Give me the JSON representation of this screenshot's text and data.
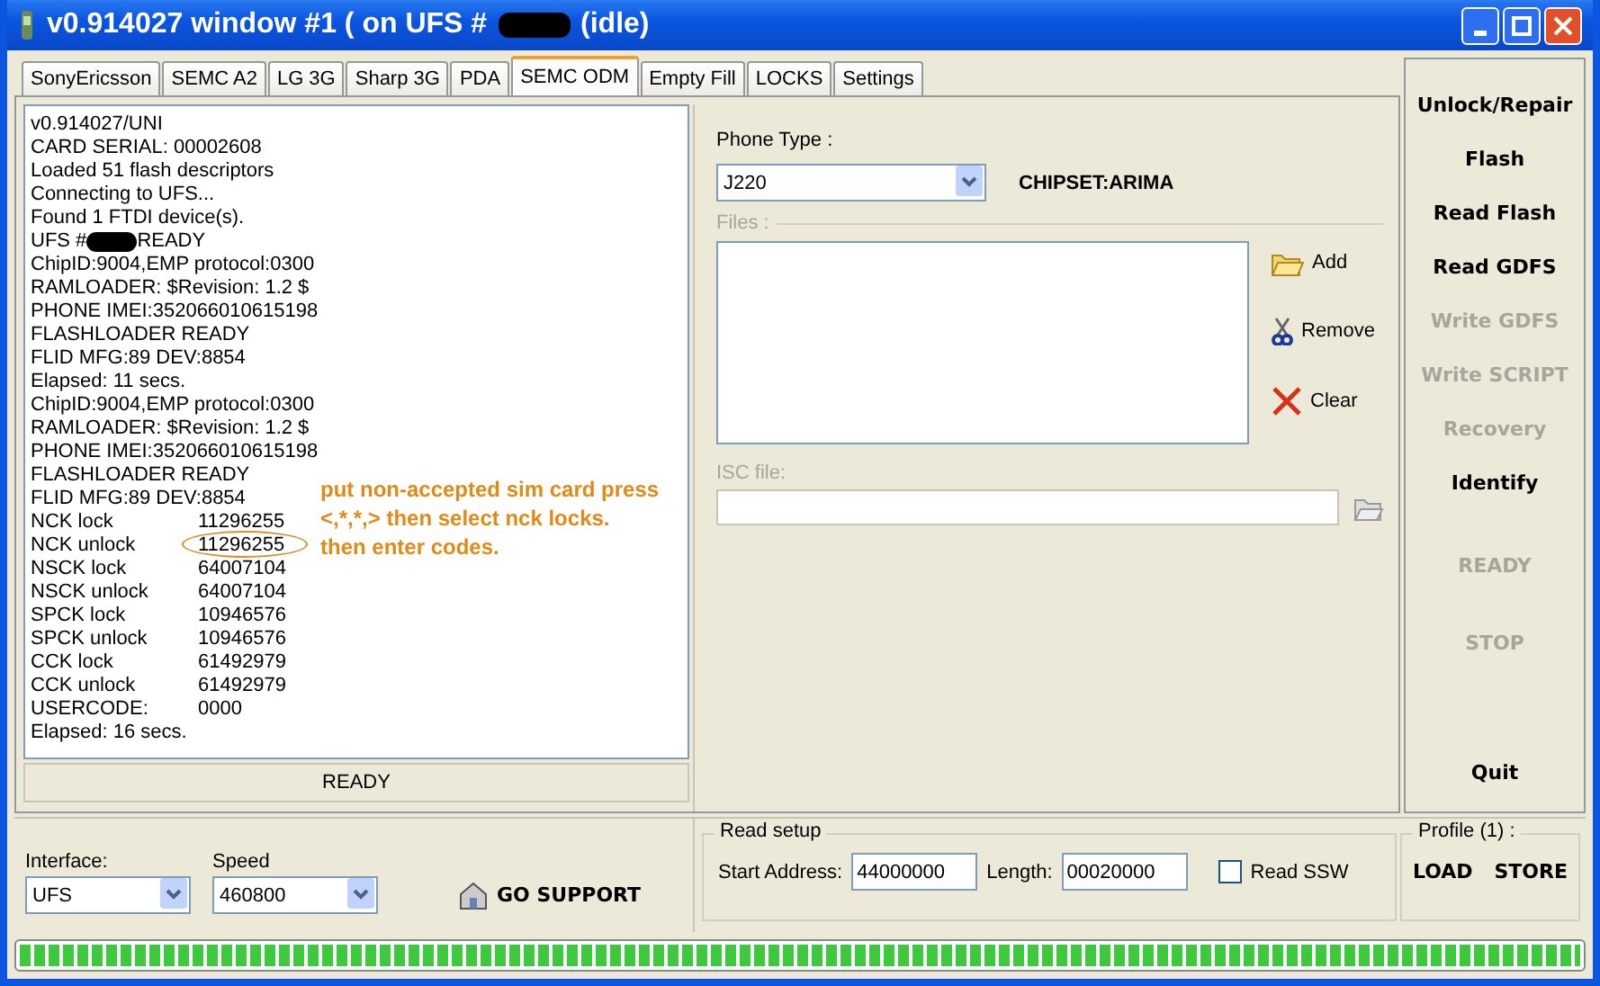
{
  "window": {
    "title_before": "v0.914027 window #1 ( on UFS #",
    "title_after": "(idle)"
  },
  "tabs": [
    {
      "label": "SonyEricsson",
      "selected": false
    },
    {
      "label": "SEMC A2",
      "selected": false
    },
    {
      "label": "LG 3G",
      "selected": false
    },
    {
      "label": "Sharp 3G",
      "selected": false
    },
    {
      "label": "PDA",
      "selected": false
    },
    {
      "label": "SEMC ODM",
      "selected": true
    },
    {
      "label": "Empty Fill",
      "selected": false
    },
    {
      "label": "LOCKS",
      "selected": false
    },
    {
      "label": "Settings",
      "selected": false
    }
  ],
  "log": {
    "lines": [
      {
        "kind": "text",
        "text": "v0.914027/UNI"
      },
      {
        "kind": "text",
        "text": "CARD SERIAL: 00002608"
      },
      {
        "kind": "text",
        "text": "Loaded 51 flash descriptors"
      },
      {
        "kind": "text",
        "text": "Connecting to UFS..."
      },
      {
        "kind": "text",
        "text": "Found 1 FTDI device(s)."
      },
      {
        "kind": "redacted",
        "before": "UFS #",
        "after": "READY"
      },
      {
        "kind": "text",
        "text": "ChipID:9004,EMP protocol:0300"
      },
      {
        "kind": "text",
        "text": "RAMLOADER: $Revision: 1.2 $"
      },
      {
        "kind": "text",
        "text": "PHONE IMEI:352066010615198"
      },
      {
        "kind": "text",
        "text": "FLASHLOADER READY"
      },
      {
        "kind": "text",
        "text": "FLID MFG:89 DEV:8854"
      },
      {
        "kind": "text",
        "text": "Elapsed: 11 secs."
      },
      {
        "kind": "text",
        "text": "ChipID:9004,EMP protocol:0300"
      },
      {
        "kind": "text",
        "text": "RAMLOADER: $Revision: 1.2 $"
      },
      {
        "kind": "text",
        "text": "PHONE IMEI:352066010615198"
      },
      {
        "kind": "text",
        "text": "FLASHLOADER READY"
      },
      {
        "kind": "text",
        "text": "FLID MFG:89 DEV:8854"
      },
      {
        "kind": "pair",
        "label": "NCK lock",
        "value": "11296255",
        "circled": false
      },
      {
        "kind": "pair",
        "label": "NCK unlock",
        "value": "11296255",
        "circled": true
      },
      {
        "kind": "pair",
        "label": "NSCK lock",
        "value": "64007104",
        "circled": false
      },
      {
        "kind": "pair",
        "label": "NSCK unlock",
        "value": "64007104",
        "circled": false
      },
      {
        "kind": "pair",
        "label": "SPCK lock",
        "value": "10946576",
        "circled": false
      },
      {
        "kind": "pair",
        "label": "SPCK unlock",
        "value": "10946576",
        "circled": false
      },
      {
        "kind": "pair",
        "label": "CCK lock",
        "value": "61492979",
        "circled": false
      },
      {
        "kind": "pair",
        "label": "CCK unlock",
        "value": "61492979",
        "circled": false
      },
      {
        "kind": "pair",
        "label": "USERCODE:",
        "value": "0000",
        "circled": false
      },
      {
        "kind": "text",
        "text": "Elapsed: 16 secs."
      }
    ],
    "status": "READY"
  },
  "annotation": {
    "lines": [
      "put non-accepted sim card press",
      "<,*,*,> then select nck locks.",
      "then enter codes."
    ]
  },
  "phone_type": {
    "label": "Phone Type :",
    "value": "J220",
    "chipset": "CHIPSET:ARIMA"
  },
  "files": {
    "label": "Files :",
    "buttons": [
      {
        "kind": "add",
        "label": "Add"
      },
      {
        "kind": "remove",
        "label": "Remove"
      },
      {
        "kind": "clear",
        "label": "Clear"
      }
    ]
  },
  "misc_file": {
    "label": "ISC file:"
  },
  "actions": [
    {
      "label": "Unlock/Repair",
      "disabled": false
    },
    {
      "label": "Flash",
      "disabled": false
    },
    {
      "label": "Read Flash",
      "disabled": false
    },
    {
      "label": "Read GDFS",
      "disabled": false
    },
    {
      "label": "Write GDFS",
      "disabled": true
    },
    {
      "label": "Write SCRIPT",
      "disabled": true
    },
    {
      "label": "Recovery",
      "disabled": true
    },
    {
      "label": "Identify",
      "disabled": false
    },
    {
      "label": "READY",
      "disabled": true
    },
    {
      "label": "STOP",
      "disabled": true
    },
    {
      "label": "Quit",
      "disabled": false
    }
  ],
  "connection": {
    "interface_label": "Interface:",
    "interface": "UFS",
    "speed_label": "Speed",
    "speed": "460800",
    "support": "GO SUPPORT"
  },
  "read_setup": {
    "title": "Read setup",
    "start_label": "Start Address:",
    "start": "44000000",
    "length_label": "Length:",
    "length": "00020000",
    "read_ssw": {
      "label": "Read SSW",
      "checked": false
    }
  },
  "profile": {
    "title": "Profile (1) :",
    "buttons": [
      "LOAD",
      "STORE"
    ]
  },
  "progress": {
    "level": 1
  }
}
